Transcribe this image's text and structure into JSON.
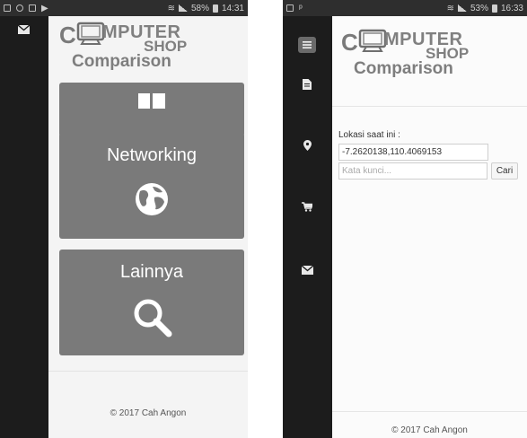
{
  "left_screen": {
    "status": {
      "battery": "58%",
      "time": "14:31"
    },
    "logo": {
      "c": "C",
      "mputer": "MPUTER",
      "shop": "SHOP",
      "comparison": "Comparison"
    },
    "tiles": [
      {
        "label": "",
        "icon": "windows-icon"
      },
      {
        "label": "Networking",
        "icon": "globe-icon"
      },
      {
        "label": "Lainnya",
        "icon": "search-icon"
      }
    ],
    "footer": "© 2017 Cah Angon"
  },
  "right_screen": {
    "status": {
      "battery": "53%",
      "time": "16:33"
    },
    "sidebar_icons": [
      "menu-icon",
      "document-icon",
      "map-marker-icon",
      "cart-icon",
      "envelope-icon"
    ],
    "logo": {
      "c": "C",
      "mputer": "MPUTER",
      "shop": "SHOP",
      "comparison": "Comparison"
    },
    "location_label": "Lokasi saat ini :",
    "location_value": "-7.2620138,110.4069153",
    "search": {
      "placeholder": "Kata kunci...",
      "button": "Cari"
    },
    "footer": "© 2017 Cah Angon"
  },
  "colors": {
    "sidebar": "#1c1c1c",
    "tile": "#7a7a7a",
    "statusbar": "#2e2e2e"
  }
}
